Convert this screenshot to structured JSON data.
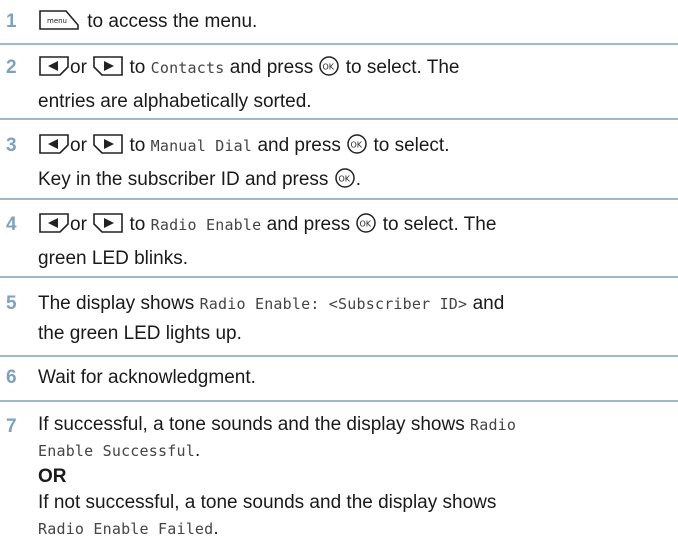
{
  "steps": [
    {
      "number": "1",
      "text": "to access the menu.",
      "menu_key": "menu"
    },
    {
      "number": "2",
      "or": "or",
      "to": "to",
      "target": "Contacts",
      "press": "and press",
      "after": "to select. The",
      "line2": "entries are alphabetically sorted."
    },
    {
      "number": "3",
      "or": "or",
      "to": "to",
      "target": "Manual Dial",
      "press": "and press",
      "after": "to select.",
      "line2": "Key in the subscriber ID and press",
      "line2_end": "."
    },
    {
      "number": "4",
      "or": "or",
      "to": "to",
      "target": "Radio Enable",
      "press": "and press",
      "after": "to select. The",
      "line2": "green LED blinks."
    },
    {
      "number": "5",
      "pre": "The display shows",
      "mono": "Radio Enable: <Subscriber ID>",
      "post": "and",
      "line2": "the green LED lights up."
    },
    {
      "number": "6",
      "text": "Wait for acknowledgment."
    },
    {
      "number": "7",
      "line1": "If successful, a tone sounds and the display shows",
      "mono1a": "Radio",
      "mono1b": "Enable Successful",
      "mono1b_end": ".",
      "or": "OR",
      "line4": "If not successful, a tone sounds and the display shows",
      "mono2": "Radio Enable Failed",
      "mono2_end": "."
    }
  ],
  "icons": {
    "ok_label": "OK",
    "menu_label": "menu"
  },
  "colors": {
    "step_number": "#7da1be",
    "rule": "#9fb8cc",
    "text": "#1a1a1a"
  }
}
